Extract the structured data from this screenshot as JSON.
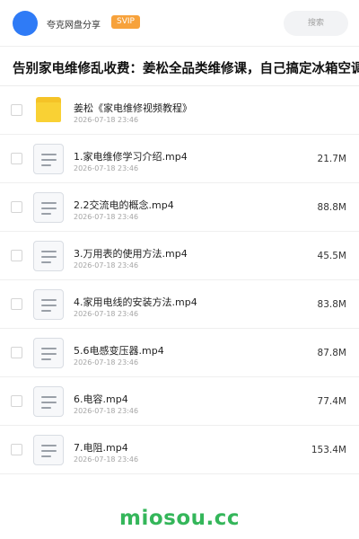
{
  "header": {
    "site_name": "夸克网盘分享",
    "badge": "SVIP",
    "search_label": "搜索",
    "avatar_color": "#2f7bf6",
    "badge_color": "#f7a23b"
  },
  "title": "告别家电维修乱收费：姜松全品类维修课，自己搞定冰箱空调洗衣机",
  "files": [
    {
      "icon": "folder-icon",
      "name": "姜松《家电维修视频教程》",
      "date": "2026-07-18 23:46",
      "size": ""
    },
    {
      "icon": "file-icon",
      "name": "1.家电维修学习介绍.mp4",
      "date": "2026-07-18 23:46",
      "size": "21.7M"
    },
    {
      "icon": "file-icon",
      "name": "2.2交流电的概念.mp4",
      "date": "2026-07-18 23:46",
      "size": "88.8M"
    },
    {
      "icon": "file-icon",
      "name": "3.万用表的使用方法.mp4",
      "date": "2026-07-18 23:46",
      "size": "45.5M"
    },
    {
      "icon": "file-icon",
      "name": "4.家用电线的安装方法.mp4",
      "date": "2026-07-18 23:46",
      "size": "83.8M"
    },
    {
      "icon": "file-icon",
      "name": "5.6电感变压器.mp4",
      "date": "2026-07-18 23:46",
      "size": "87.8M"
    },
    {
      "icon": "file-icon",
      "name": "6.电容.mp4",
      "date": "2026-07-18 23:46",
      "size": "77.4M"
    },
    {
      "icon": "file-icon",
      "name": "7.电阻.mp4",
      "date": "2026-07-18 23:46",
      "size": "153.4M"
    }
  ],
  "watermark": "miosou.cc",
  "watermark_color": "#34b65a"
}
